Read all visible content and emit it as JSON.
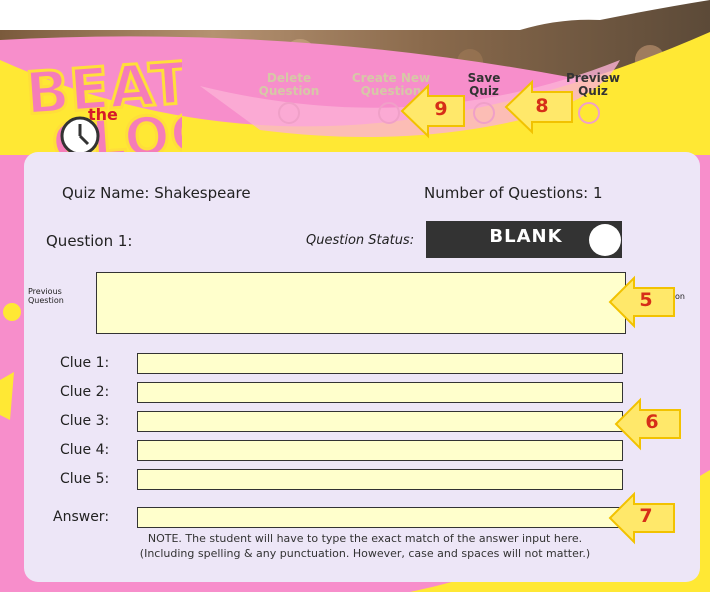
{
  "logo": {
    "word_top": "BEAT",
    "word_middle": "the",
    "word_bottom": "CLOCK"
  },
  "nav": {
    "delete": "Delete Question",
    "create": "Create New Question",
    "save": "Save Quiz",
    "preview": "Preview Quiz"
  },
  "quiz": {
    "name_label": "Quiz Name: Shakespeare",
    "count_label": "Number of Questions: 1",
    "question_label": "Question 1:",
    "status_label": "Question Status:",
    "status_value": "BLANK",
    "previous_question": "Previous Question",
    "next_fragment": "on"
  },
  "clues": [
    {
      "label": "Clue 1:",
      "value": ""
    },
    {
      "label": "Clue 2:",
      "value": ""
    },
    {
      "label": "Clue 3:",
      "value": ""
    },
    {
      "label": "Clue 4:",
      "value": ""
    },
    {
      "label": "Clue 5:",
      "value": ""
    }
  ],
  "answer": {
    "label": "Answer:",
    "value": ""
  },
  "note": {
    "line1": "NOTE. The student will have to type the exact match of the answer input here.",
    "line2": "(Including spelling & any punctuation. However, case and spaces will not matter.)"
  },
  "callouts": {
    "c9": "9",
    "c8": "8",
    "c5": "5",
    "c6": "6",
    "c7": "7"
  },
  "colors": {
    "pink": "#f78ecb",
    "yellow": "#ffe834",
    "panel": "#ede6f7",
    "field": "#ffffcc",
    "callout_text": "#d62e18"
  }
}
